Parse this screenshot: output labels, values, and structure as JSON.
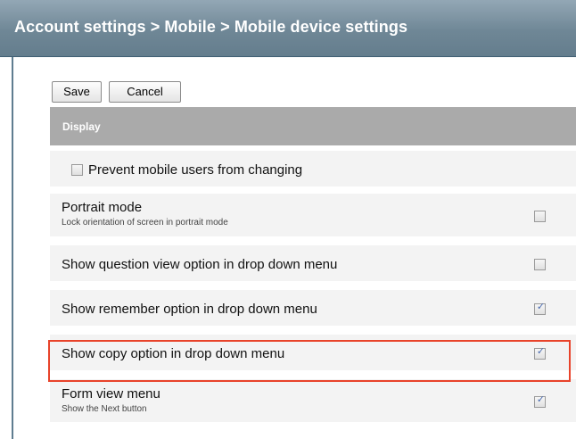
{
  "header": {
    "title": "Account settings > Mobile > Mobile device settings"
  },
  "toolbar": {
    "save_label": "Save",
    "cancel_label": "Cancel"
  },
  "section": {
    "label": "Display"
  },
  "settings": [
    {
      "label": "Prevent mobile users from changing",
      "checked": false
    },
    {
      "label": "Portrait mode",
      "description": "Lock orientation of screen in portrait mode",
      "checked": false
    },
    {
      "label": "Show question view option in drop down menu",
      "checked": false
    },
    {
      "label": "Show remember option in drop down menu",
      "checked": true
    },
    {
      "label": "Show copy option in drop down menu",
      "checked": true,
      "highlighted": true
    },
    {
      "label": "Form view menu",
      "description": "Show the Next button",
      "checked": true
    }
  ],
  "colors": {
    "header_bar": "#6f8796",
    "section_bar": "#aaaaaa",
    "row_background": "#f3f3f3",
    "highlight_border": "#e8432a",
    "checkmark": "#4a6bb0"
  }
}
